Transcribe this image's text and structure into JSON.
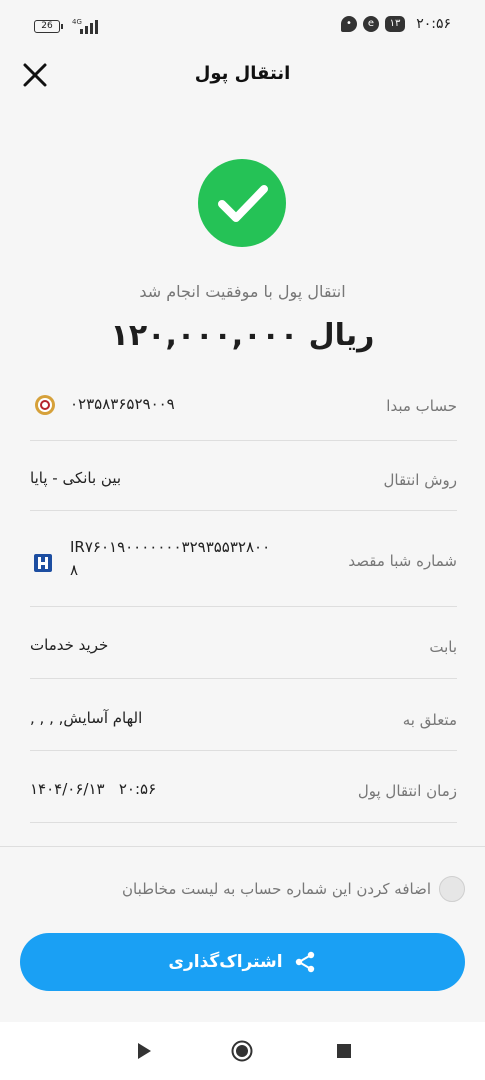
{
  "status_bar": {
    "time": "۲۰:۵۶",
    "battery": "26",
    "notification_badge": "۱۳"
  },
  "header": {
    "title": "انتقال پول"
  },
  "result": {
    "message": "انتقال پول با موفقیت انجام شد",
    "amount": "۱۲۰,۰۰۰,۰۰۰ ریال"
  },
  "details": [
    {
      "label": "حساب مبدا",
      "value": "۰۲۳۵۸۳۶۵۲۹۰۰۹"
    },
    {
      "label": "روش انتقال",
      "value": "بین بانکی - پایا"
    },
    {
      "label": "شماره شبا مقصد",
      "value_line1": "IR۷۶۰۱۹۰۰۰۰۰۰۰۳۲۹۳۵۵۳۲۸۰۰",
      "value_line2": "۸"
    },
    {
      "label": "بابت",
      "value": "خرید خدمات"
    },
    {
      "label": "متعلق به",
      "value": "الهام آسایش, , , ,"
    },
    {
      "label": "زمان انتقال پول",
      "value": "۱۴۰۴/۰۶/۱۳   ۲۰:۵۶"
    }
  ],
  "add_contact": {
    "label": "اضافه کردن این شماره حساب به لیست مخاطبان"
  },
  "share_button": {
    "label": "اشتراک‌گذاری"
  },
  "colors": {
    "success": "#25c256",
    "primary": "#1aa0f4",
    "background": "#f6f6f6"
  },
  "icons": {
    "close": "close-icon",
    "success": "checkmark-icon",
    "share": "share-icon",
    "source_bank": "bank-melli-icon",
    "dest_bank": "bank-saderat-icon"
  }
}
